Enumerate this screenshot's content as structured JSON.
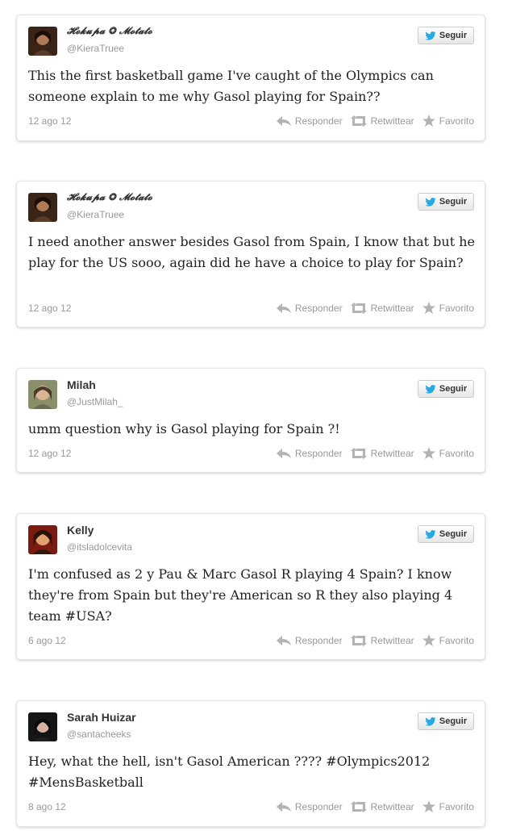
{
  "colors": {
    "bird_blue": "#2aa9e0",
    "muted": "#999999",
    "icon_gray": "#b3b3b3"
  },
  "labels": {
    "follow": "Seguir",
    "reply": "Responder",
    "retweet": "Retwittear",
    "favorite": "Favorito"
  },
  "tweets": [
    {
      "name": "𝓗𝓸𝓴𝓾𝓹𝓪 ❂ 𝓜𝓸𝓽𝓪𝓽𝓸",
      "handle": "@KieraTruee",
      "text": "This the first basketball game I've caught of the Olympics can someone explain to me why Gasol playing for Spain??",
      "date": "12 ago 12",
      "avatar": "avatar-dark-hair-1"
    },
    {
      "name": "𝓗𝓸𝓴𝓾𝓹𝓪 ❂ 𝓜𝓸𝓽𝓪𝓽𝓸",
      "handle": "@KieraTruee",
      "text": "I need another answer besides Gasol from Spain, I know that but he play for the US sooo, again did he have a choice to play for Spain?",
      "date": "12 ago 12",
      "avatar": "avatar-dark-hair-1"
    },
    {
      "name": "Milah",
      "handle": "@JustMilah_",
      "text": "umm question why is Gasol playing for Spain ?!",
      "date": "12 ago 12",
      "avatar": "avatar-light"
    },
    {
      "name": "Kelly",
      "handle": "@itsladolcevita",
      "text": "I'm confused as 2 y Pau & Marc Gasol R playing 4 Spain? I know they're from Spain but they're American so R they also playing 4 team #USA?",
      "date": "6 ago 12",
      "avatar": "avatar-red"
    },
    {
      "name": "Sarah Huizar",
      "handle": "@santacheeks",
      "text": "Hey, what the hell, isn't Gasol American ???? #Olympics2012 #MensBasketball",
      "date": "8 ago 12",
      "avatar": "avatar-dark-hair-2"
    }
  ]
}
